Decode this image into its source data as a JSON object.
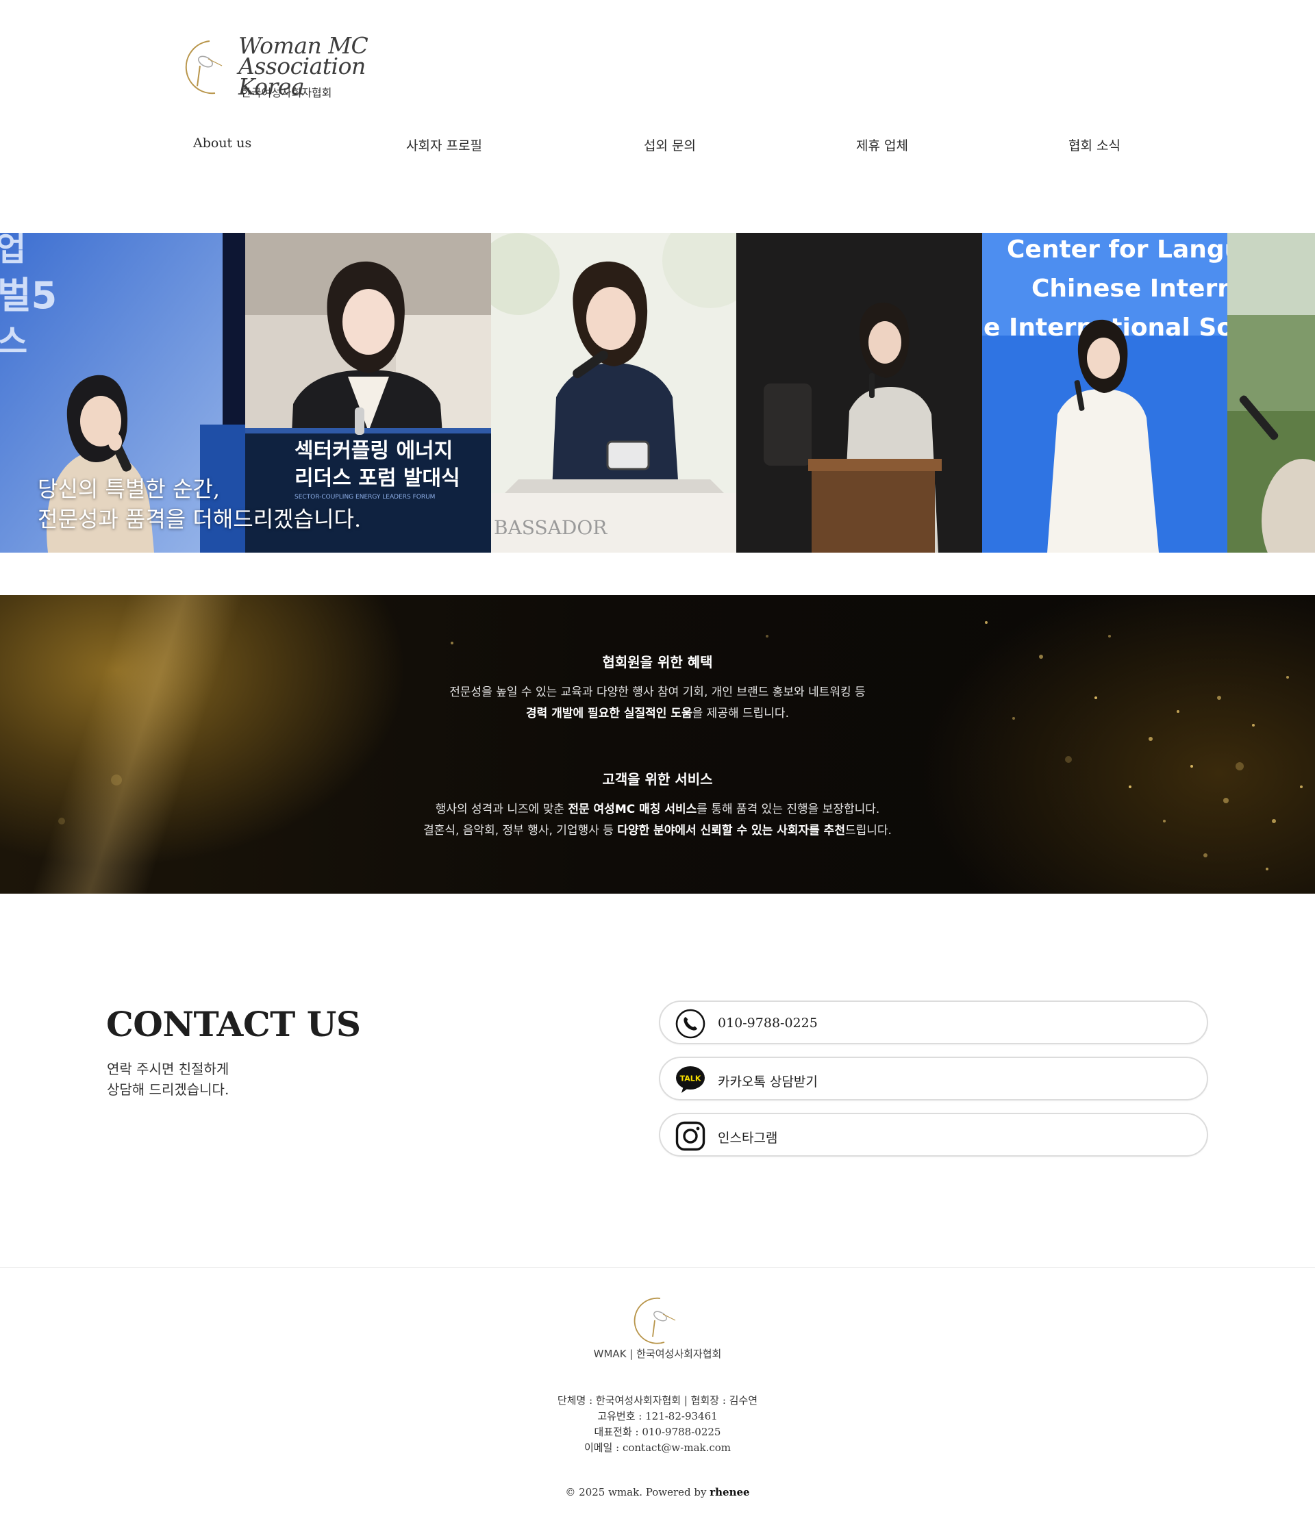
{
  "header": {
    "logo_en_line1": "Woman MC",
    "logo_en_line2": "Association Korea",
    "logo_kr": "한국여성사회자협회"
  },
  "nav": {
    "items": [
      {
        "label": "About us"
      },
      {
        "label": "사회자 프로필"
      },
      {
        "label": "섭외 문의"
      },
      {
        "label": "제휴 업체"
      },
      {
        "label": "협회 소식"
      }
    ]
  },
  "hero": {
    "caption_line1": "당신의 특별한 순간,",
    "caption_line2": "전문성과 품격을 더해드리겠습니다.",
    "panel2_sign_line1": "섹터커플링 에너지",
    "panel2_sign_line2": "리더스 포럼 발대식",
    "panel2_sign_sub": "SECTOR-COUPLING ENERGY LEADERS FORUM",
    "panel3_podium": "BASSADOR",
    "panel5_banner_line1": "Center for Langu",
    "panel5_banner_line2": "Chinese Interna",
    "panel5_banner_line3": "e International Soc"
  },
  "benefits": {
    "member_title": "협회원을 위한 혜택",
    "member_line1": "전문성을 높일 수 있는 교육과 다양한 행사 참여 기회, 개인 브랜드 홍보와 네트워킹 등",
    "member_line2_bold": "경력 개발에 필요한 실질적인 도움",
    "member_line2_rest": "을 제공해 드립니다.",
    "client_title": "고객을 위한 서비스",
    "client_line1_pre": "행사의 성격과 니즈에 맞춘 ",
    "client_line1_bold": "전문 여성MC 매칭 서비스",
    "client_line1_post": "를 통해 품격 있는 진행을 보장합니다.",
    "client_line2_pre": "결혼식, 음악회, 정부 행사, 기업행사 등 ",
    "client_line2_bold": "다양한 분야에서 신뢰할 수 있는 사회자를 추천",
    "client_line2_post": "드립니다."
  },
  "contact": {
    "title": "CONTACT US",
    "subtitle": "연락 주시면 친절하게\n상담해 드리겠습니다.",
    "buttons": [
      {
        "label": "010-9788-0225",
        "icon": "phone-icon"
      },
      {
        "label": "카카오톡 상담받기",
        "icon": "kakaotalk-icon",
        "icon_text": "TALK"
      },
      {
        "label": "인스타그램",
        "icon": "instagram-icon"
      }
    ]
  },
  "footer": {
    "brand": "WMAK | 한국여성사회자협회",
    "org": "단체명 : 한국여성사회자협회 | 협회장 : 김수연",
    "reg": "고유번호 : 121-82-93461",
    "tel": "대표전화 : 010-9788-0225",
    "email": "이메일 : contact@w-mak.com",
    "copyright_prefix": "© 2025 wmak. Powered by ",
    "copyright_brand": "rhenee"
  },
  "colors": {
    "accent_gold": "#b8954a",
    "section_dark": "#0e0b07",
    "kakao_yellow": "#f9e000"
  }
}
